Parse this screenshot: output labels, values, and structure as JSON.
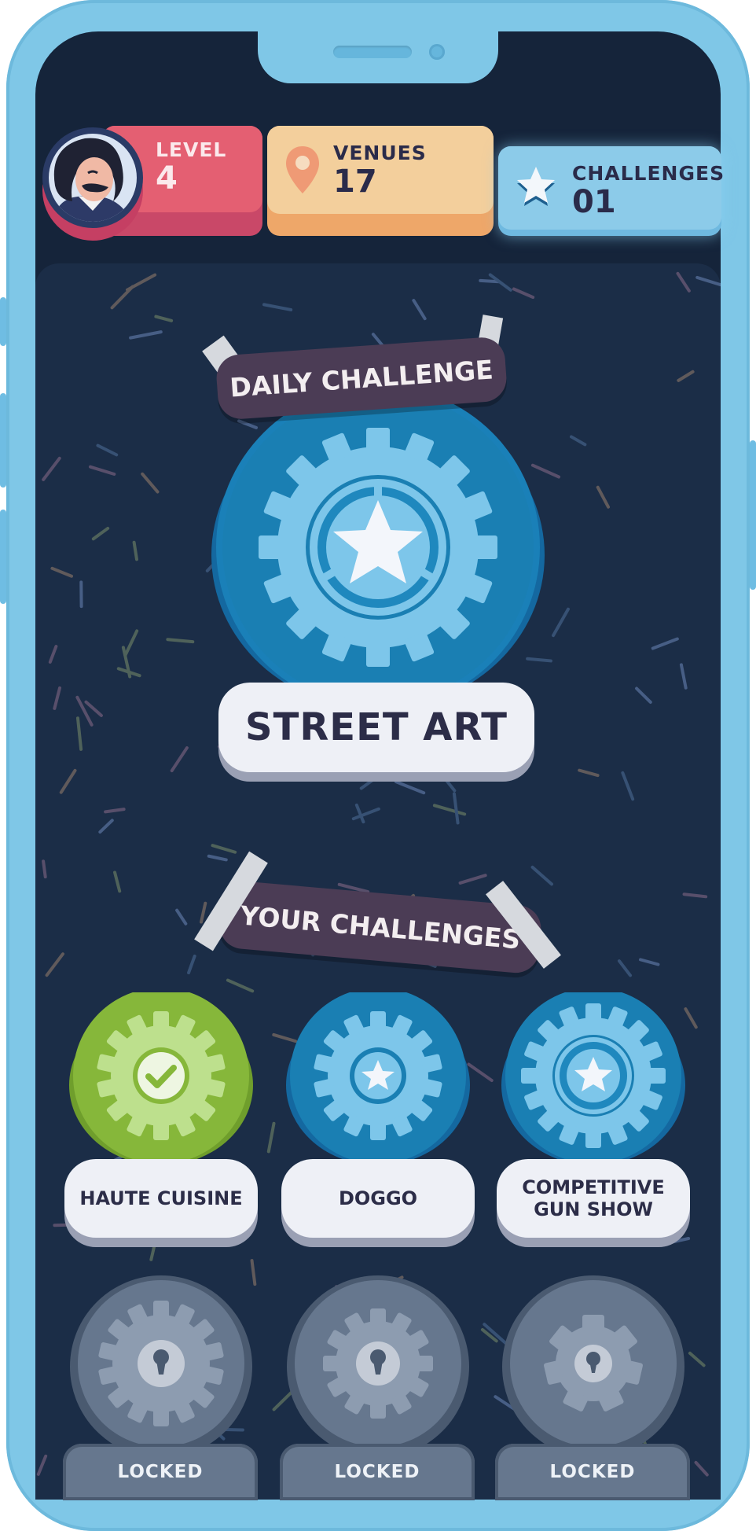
{
  "stats": {
    "level": {
      "label": "LEVEL",
      "value": "4"
    },
    "venues": {
      "label": "VENUES",
      "value": "17"
    },
    "challenges": {
      "label": "CHALLENGES",
      "value": "01"
    }
  },
  "daily": {
    "banner": "DAILY CHALLENGE",
    "title": "STREET ART"
  },
  "your_challenges": {
    "banner": "YOUR CHALLENGES",
    "items": [
      {
        "label": "HAUTE CUISINE",
        "icon": "checkmark-gear-icon",
        "status": "completed"
      },
      {
        "label": "DOGGO",
        "icon": "star-gear-icon",
        "status": "available"
      },
      {
        "label_line1": "COMPETITIVE",
        "label_line2": "GUN SHOW",
        "icon": "star-gear-icon",
        "status": "available"
      }
    ],
    "locked": [
      {
        "label": "LOCKED"
      },
      {
        "label": "LOCKED"
      },
      {
        "label": "LOCKED"
      }
    ]
  },
  "colors": {
    "frame": "#7fc7e7",
    "panel": "#1b2d47",
    "level_card": "#e25f72",
    "venues_card": "#f2c99a",
    "challenges_card": "#8ccbe9",
    "badge_blue": "#1a7fb3",
    "badge_green": "#86b73a",
    "badge_locked": "#66778e",
    "banner": "#4b3c55"
  }
}
